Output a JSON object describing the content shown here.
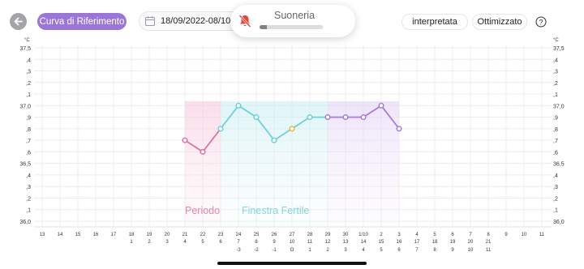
{
  "header": {
    "back_icon": "arrow-left-icon",
    "reference_button": "Curva di Riferimento",
    "date_range": "18/09/2022-08/10/2022",
    "calendar_icon": "calendar-icon",
    "toggle_interpreted": "interpretata",
    "toggle_optimized": "Ottimizzato",
    "help_icon": "question-circle-icon"
  },
  "ringer_overlay": {
    "label": "Suoneria",
    "icon": "bell-slash-icon",
    "level": 0.12,
    "icon_color": "#e0463c"
  },
  "colors": {
    "period": "#e0709e",
    "fertile": "#6fcfd8",
    "luteal": "#a67ad9",
    "ovulation": "#f3b23e",
    "grid": "#ececec",
    "accent_button": "#9b76d6"
  },
  "chart_data": {
    "type": "line",
    "unit": "°C",
    "ylim": [
      36.0,
      37.5
    ],
    "y_ticks": [
      "37,5",
      ",4",
      ",3",
      ",2",
      ",1",
      "37,0",
      ",9",
      ",8",
      ",7",
      ",6",
      "36,5",
      ",4",
      ",3",
      ",2",
      ",1",
      "36,0"
    ],
    "x_dates": [
      "13",
      "14",
      "15",
      "16",
      "17",
      "18",
      "19",
      "20",
      "21",
      "22",
      "23",
      "24",
      "25",
      "26",
      "27",
      "28",
      "29",
      "30",
      "1/10",
      "2",
      "3",
      "4",
      "5",
      "6",
      "7",
      "8",
      "9",
      "10",
      "11"
    ],
    "x_cycle_days": [
      "",
      "",
      "",
      "",
      "",
      "1",
      "2",
      "3",
      "4",
      "5",
      "6",
      "7",
      "8",
      "9",
      "10",
      "11",
      "12",
      "13",
      "14",
      "15",
      "16",
      "17",
      "18",
      "19",
      "20",
      "21",
      "",
      "",
      ""
    ],
    "x_ovulation_offsets": [
      "",
      "",
      "",
      "",
      "",
      "",
      "",
      "",
      "",
      "",
      "",
      "-3",
      "-2",
      "-1",
      "O",
      "1",
      "2",
      "3",
      "4",
      "5",
      "6",
      "7",
      "8",
      "9",
      "10",
      "11",
      "",
      "",
      ""
    ],
    "series": [
      {
        "dates": [
          "21",
          "22",
          "23",
          "24",
          "25",
          "26",
          "27",
          "28",
          "29",
          "30",
          "1/10",
          "2",
          "3"
        ],
        "values": [
          36.7,
          36.6,
          36.8,
          37.0,
          36.9,
          36.7,
          36.8,
          36.9,
          36.9,
          36.9,
          36.9,
          37.0,
          36.8
        ]
      }
    ],
    "ovulation_date": "27",
    "phases": [
      {
        "name": "Periodo",
        "from": "21",
        "to": "23"
      },
      {
        "name": "Finestra Fertile",
        "from": "23",
        "to": "29"
      },
      {
        "name": "",
        "from": "29",
        "to": "3"
      }
    ]
  }
}
